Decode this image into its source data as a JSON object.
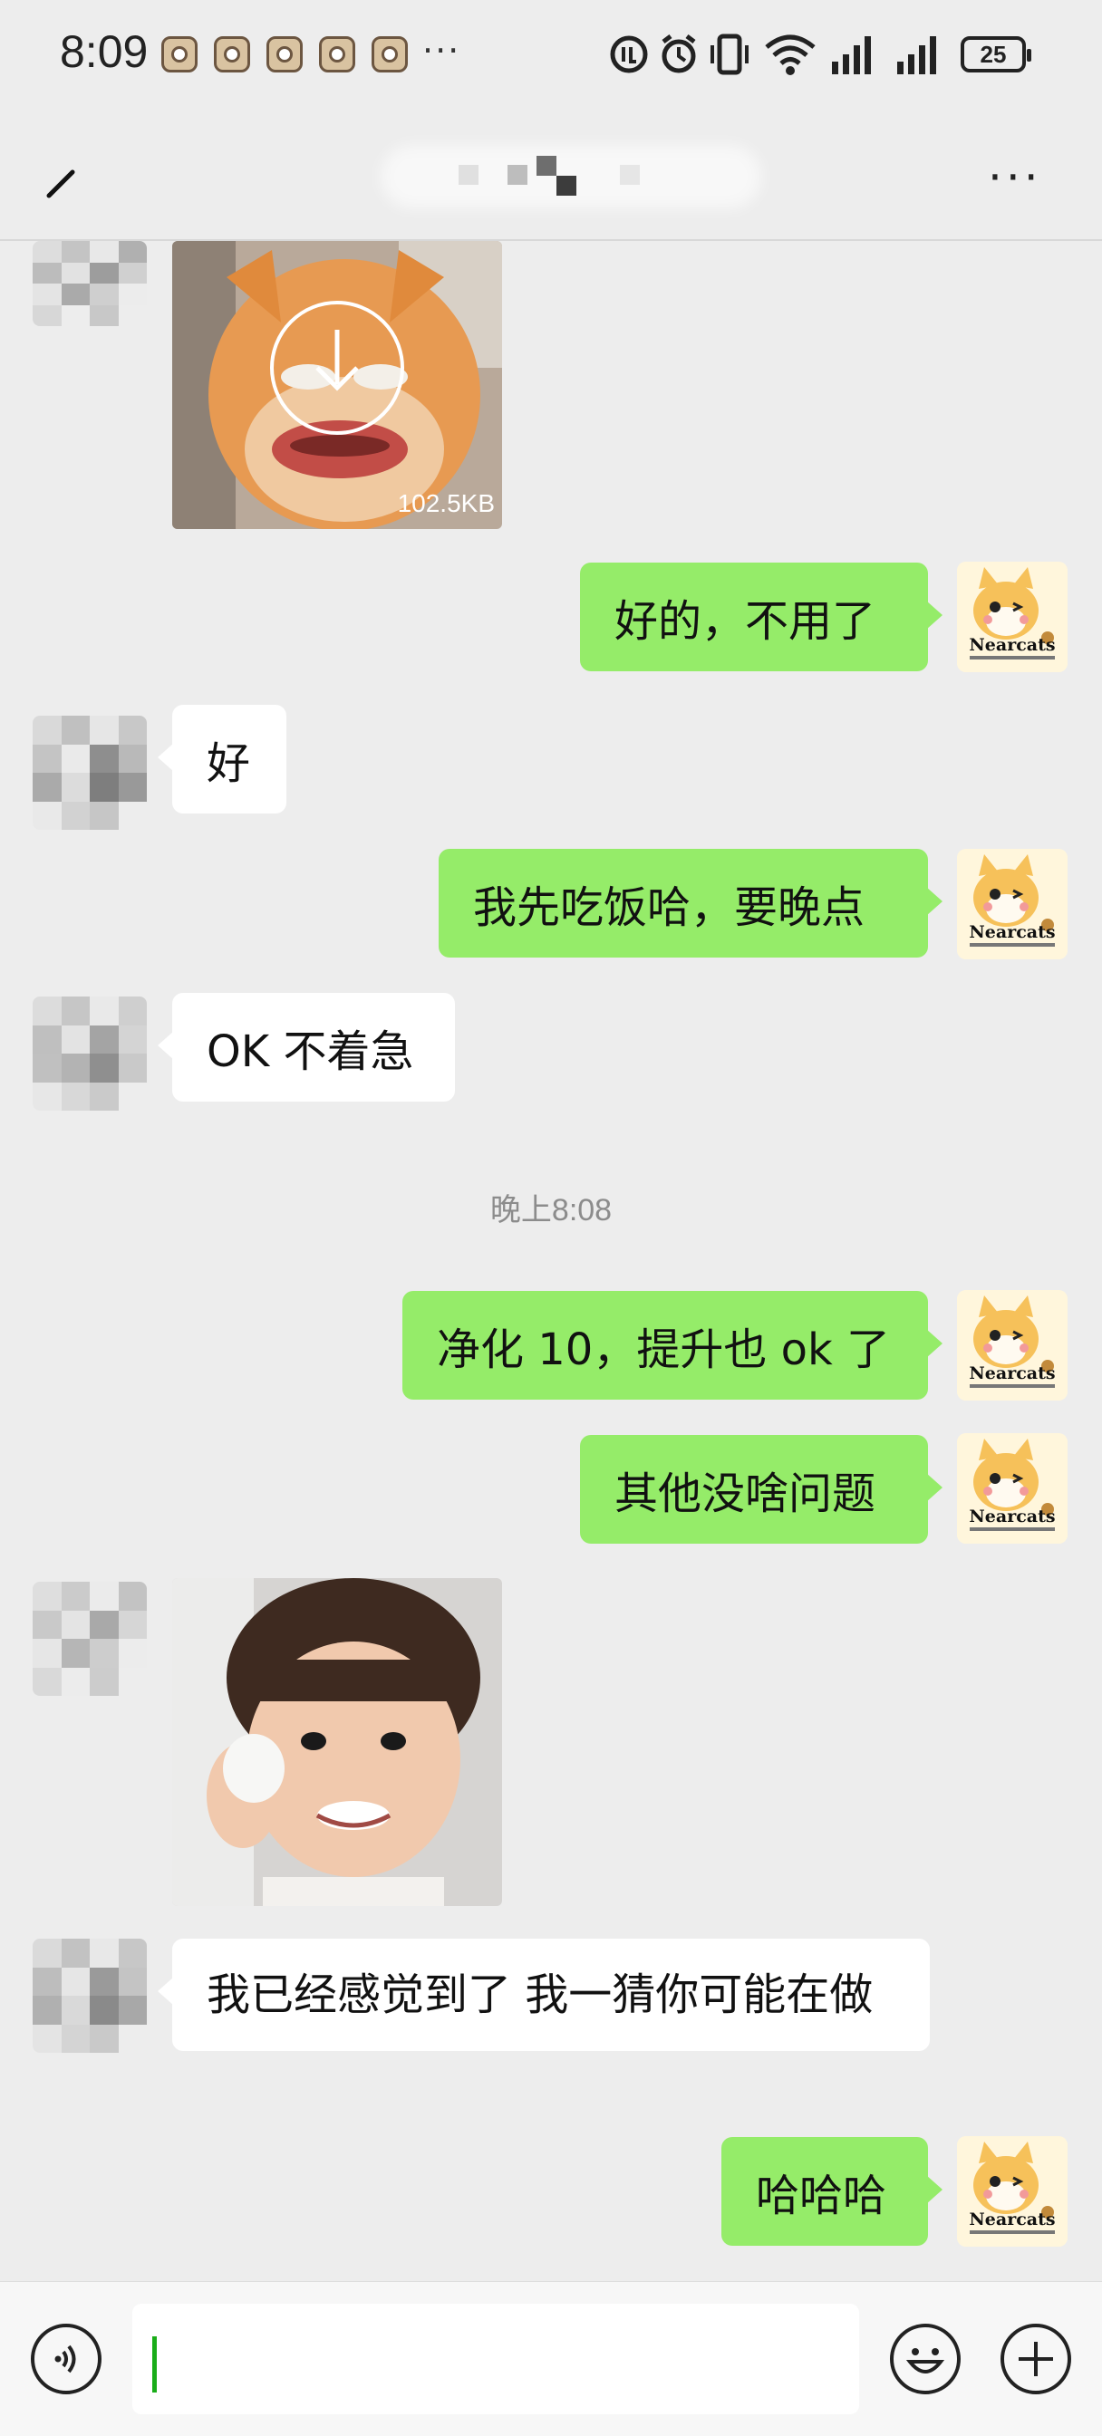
{
  "status_bar": {
    "time": "8:09",
    "battery": "25"
  },
  "header": {
    "back_icon": "back-arrow-icon",
    "more_icon": "more-icon"
  },
  "messages": [
    {
      "sender": "other",
      "type": "image",
      "file_size": "102.5KB",
      "icon": "download-icon"
    },
    {
      "sender": "me",
      "type": "text",
      "text": "好的，不用了"
    },
    {
      "sender": "other",
      "type": "text",
      "text": "好"
    },
    {
      "sender": "me",
      "type": "text",
      "text": "我先吃饭哈，要晚点"
    },
    {
      "sender": "other",
      "type": "text",
      "text": "OK 不着急"
    },
    {
      "type": "timestamp",
      "text": "晚上8:08"
    },
    {
      "sender": "me",
      "type": "text",
      "text": "净化 10，提升也 ok 了"
    },
    {
      "sender": "me",
      "type": "text",
      "text": "其他没啥问题"
    },
    {
      "sender": "other",
      "type": "image"
    },
    {
      "sender": "other",
      "type": "text",
      "text": "我已经感觉到了 我一猜你可能在做"
    },
    {
      "sender": "me",
      "type": "text",
      "text": "哈哈哈"
    }
  ],
  "my_avatar": {
    "logo_text": "Nearcats"
  },
  "input_bar": {
    "value": "",
    "voice_icon": "voice-icon",
    "emoji_icon": "emoji-icon",
    "plus_icon": "plus-icon"
  },
  "colors": {
    "my_bubble": "#95ec69",
    "other_bubble": "#ffffff",
    "background": "#ededed"
  }
}
